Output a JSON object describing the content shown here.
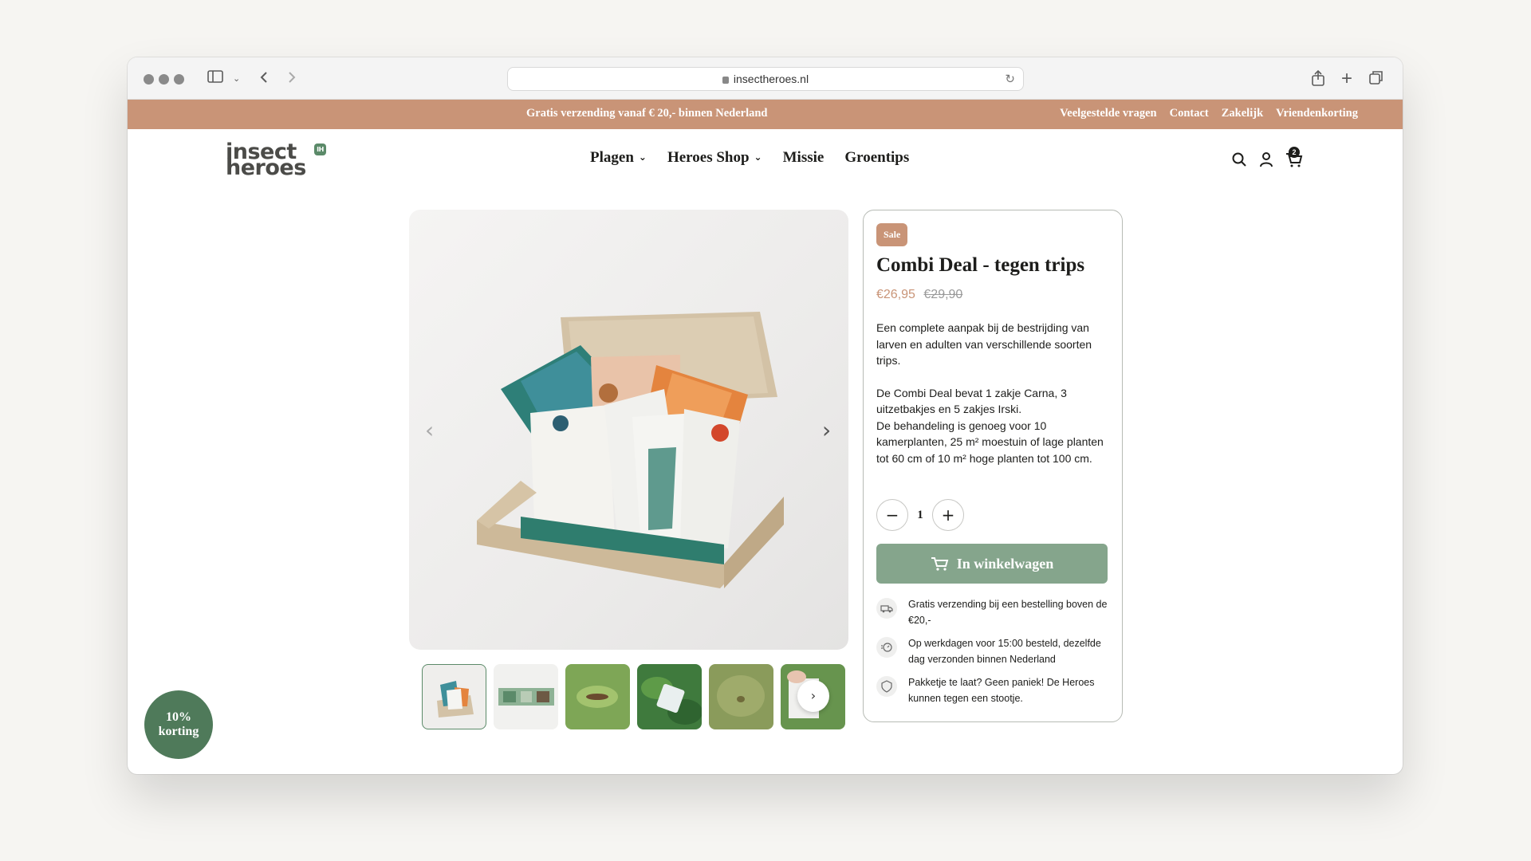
{
  "browser": {
    "url": "insectheroes.nl"
  },
  "announcement": {
    "center": "Gratis verzending vanaf € 20,- binnen Nederland",
    "links": [
      "Veelgestelde vragen",
      "Contact",
      "Zakelijk",
      "Vriendenkorting"
    ]
  },
  "header": {
    "logo_line1": "insect",
    "logo_line2": "heroes",
    "logo_badge": "IH",
    "nav": [
      {
        "label": "Plagen",
        "dropdown": true
      },
      {
        "label": "Heroes Shop",
        "dropdown": true
      },
      {
        "label": "Missie",
        "dropdown": false
      },
      {
        "label": "Groentips",
        "dropdown": false
      }
    ],
    "cart_count": "2"
  },
  "product": {
    "badge": "Sale",
    "title": "Combi Deal - tegen trips",
    "price_now": "€26,95",
    "price_was": "€29,90",
    "desc1": "Een complete aanpak bij de bestrijding van larven en adulten van verschillende soorten trips.",
    "desc2": "De Combi Deal bevat 1 zakje Carna, 3 uitzetbakjes en 5 zakjes Irski.",
    "desc3": "De behandeling is genoeg voor 10 kamerplanten, 25 m² moestuin of lage planten tot 60 cm of 10 m² hoge planten tot 100 cm.",
    "qty": "1",
    "add_to_cart": "In winkelwagen",
    "usps": [
      "Gratis verzending bij een bestelling boven de €20,-",
      "Op werkdagen voor 15:00 besteld, dezelfde dag verzonden binnen Nederland",
      "Pakketje te laat? Geen paniek! De Heroes kunnen tegen een stootje."
    ]
  },
  "gallery": {
    "prev": "‹",
    "next": "›",
    "thumb_next": "›"
  },
  "discount": {
    "line1": "10%",
    "line2": "korting"
  },
  "colors": {
    "brand_terracotta": "#c99477",
    "brand_green": "#5b8a69",
    "button_green": "#85a58c"
  }
}
